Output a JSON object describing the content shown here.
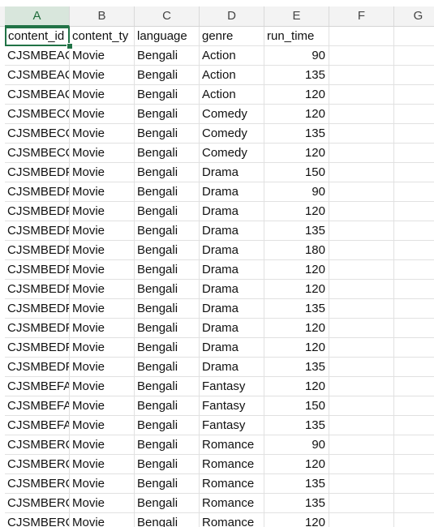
{
  "columns": [
    "A",
    "B",
    "C",
    "D",
    "E",
    "F",
    "G"
  ],
  "headers": [
    "content_id",
    "content_ty",
    "language",
    "genre",
    "run_time"
  ],
  "rows": [
    [
      "CJSMBEAC",
      "Movie",
      "Bengali",
      "Action",
      "90"
    ],
    [
      "CJSMBEAC",
      "Movie",
      "Bengali",
      "Action",
      "135"
    ],
    [
      "CJSMBEAC",
      "Movie",
      "Bengali",
      "Action",
      "120"
    ],
    [
      "CJSMBECC",
      "Movie",
      "Bengali",
      "Comedy",
      "120"
    ],
    [
      "CJSMBECC",
      "Movie",
      "Bengali",
      "Comedy",
      "135"
    ],
    [
      "CJSMBECC",
      "Movie",
      "Bengali",
      "Comedy",
      "120"
    ],
    [
      "CJSMBEDF",
      "Movie",
      "Bengali",
      "Drama",
      "150"
    ],
    [
      "CJSMBEDF",
      "Movie",
      "Bengali",
      "Drama",
      "90"
    ],
    [
      "CJSMBEDF",
      "Movie",
      "Bengali",
      "Drama",
      "120"
    ],
    [
      "CJSMBEDF",
      "Movie",
      "Bengali",
      "Drama",
      "135"
    ],
    [
      "CJSMBEDF",
      "Movie",
      "Bengali",
      "Drama",
      "180"
    ],
    [
      "CJSMBEDF",
      "Movie",
      "Bengali",
      "Drama",
      "120"
    ],
    [
      "CJSMBEDF",
      "Movie",
      "Bengali",
      "Drama",
      "120"
    ],
    [
      "CJSMBEDF",
      "Movie",
      "Bengali",
      "Drama",
      "135"
    ],
    [
      "CJSMBEDF",
      "Movie",
      "Bengali",
      "Drama",
      "120"
    ],
    [
      "CJSMBEDF",
      "Movie",
      "Bengali",
      "Drama",
      "120"
    ],
    [
      "CJSMBEDF",
      "Movie",
      "Bengali",
      "Drama",
      "135"
    ],
    [
      "CJSMBEFA",
      "Movie",
      "Bengali",
      "Fantasy",
      "120"
    ],
    [
      "CJSMBEFA",
      "Movie",
      "Bengali",
      "Fantasy",
      "150"
    ],
    [
      "CJSMBEFA",
      "Movie",
      "Bengali",
      "Fantasy",
      "135"
    ],
    [
      "CJSMBERC",
      "Movie",
      "Bengali",
      "Romance",
      "90"
    ],
    [
      "CJSMBERC",
      "Movie",
      "Bengali",
      "Romance",
      "120"
    ],
    [
      "CJSMBERC",
      "Movie",
      "Bengali",
      "Romance",
      "135"
    ],
    [
      "CJSMBERC",
      "Movie",
      "Bengali",
      "Romance",
      "135"
    ],
    [
      "CJSMBERC",
      "Movie",
      "Bengali",
      "Romance",
      "120"
    ]
  ],
  "selected_cell": "A1",
  "colors": {
    "accent": "#217346",
    "header_bg": "#f3f3f3",
    "active_header_bg": "#d8e6dc",
    "gridline": "#e1e1e1"
  }
}
